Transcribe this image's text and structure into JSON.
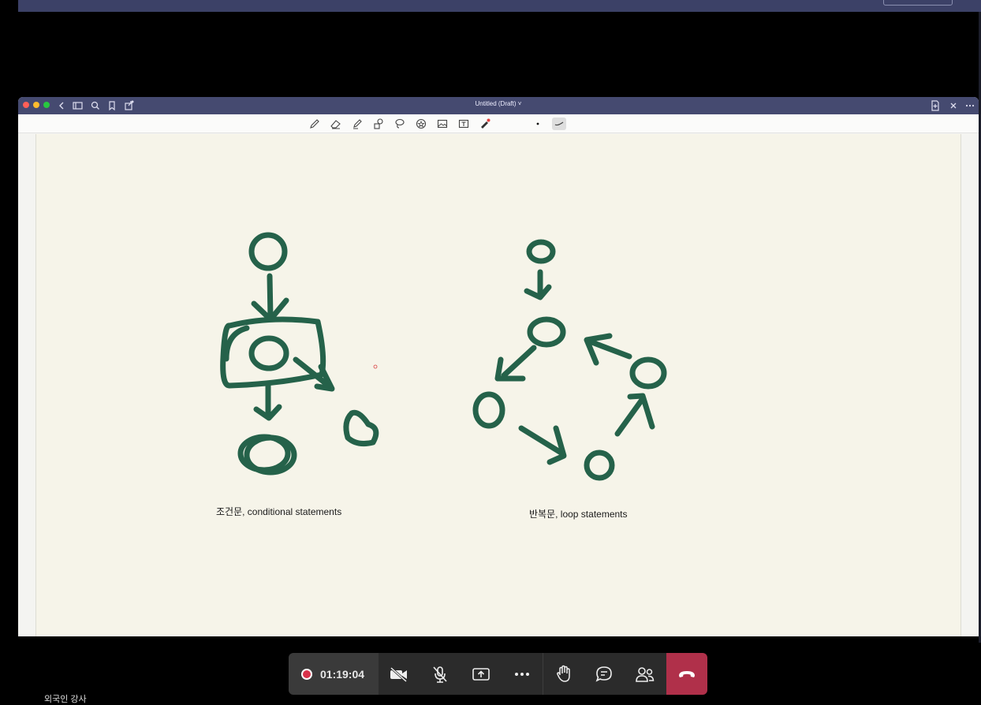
{
  "window": {
    "title": "Untitled (Draft)"
  },
  "canvas": {
    "caption_left": "조건문, conditional statements",
    "caption_right": "반복문, loop statements",
    "ink_color": "#25624a"
  },
  "call": {
    "timer": "01:19:04",
    "recording": true,
    "hangup_color": "#b0304a"
  },
  "bottom_label": "외국인 강사"
}
